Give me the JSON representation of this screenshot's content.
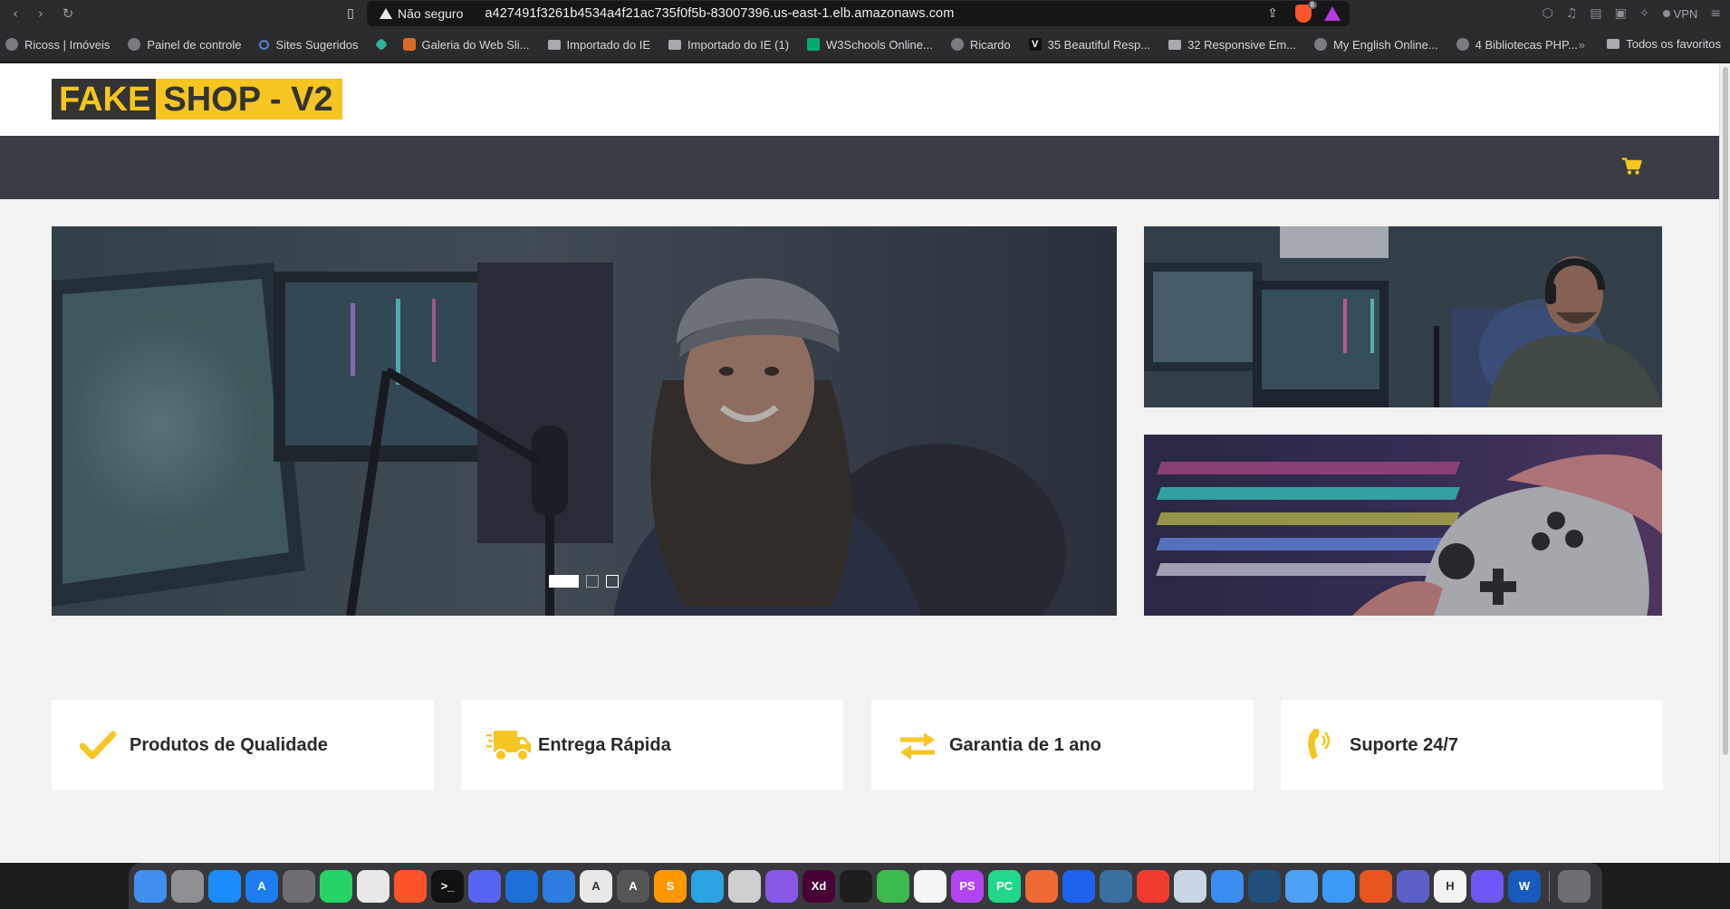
{
  "browser": {
    "security_label": "Não seguro",
    "url": "a427491f3261b4534a4f21ac735f0f5b-83007396.us-east-1.elb.amazonaws.com",
    "brave_badge": "8",
    "vpn_label": "VPN"
  },
  "bookmarks": {
    "items": [
      {
        "label": "Ricoss | Imóveis",
        "icon": "globe-icon"
      },
      {
        "label": "Painel de controle",
        "icon": "globe-icon"
      },
      {
        "label": "Sites Sugeridos",
        "icon": "search-icon"
      },
      {
        "label": "",
        "icon": "gem-icon"
      },
      {
        "label": "Galeria do Web Sli...",
        "icon": "paint-icon"
      },
      {
        "label": "Importado do IE",
        "icon": "folder-icon"
      },
      {
        "label": "Importado do IE (1)",
        "icon": "folder-icon"
      },
      {
        "label": "W3Schools Online...",
        "icon": "w3-icon"
      },
      {
        "label": "Ricardo",
        "icon": "globe-icon"
      },
      {
        "label": "35 Beautiful Resp...",
        "icon": "v-icon"
      },
      {
        "label": "32 Responsive Em...",
        "icon": "chart-icon"
      },
      {
        "label": "My English Online...",
        "icon": "globe-icon"
      },
      {
        "label": "4 Bibliotecas PHP...",
        "icon": "globe-icon"
      }
    ],
    "overflow": "»",
    "favorites_label": "Todos os favoritos"
  },
  "site": {
    "logo_part1": "FAKE",
    "logo_part2": "SHOP - V2",
    "accent_color": "#f5c522",
    "navbar_color": "#3a3d45"
  },
  "carousel": {
    "slides": 3,
    "active_index": 0
  },
  "features": [
    {
      "label": "Produtos de Qualidade",
      "icon": "check-icon"
    },
    {
      "label": "Entrega Rápida",
      "icon": "truck-icon"
    },
    {
      "label": "Garantia de 1 ano",
      "icon": "exchange-arrows-icon"
    },
    {
      "label": "Suporte 24/7",
      "icon": "phone-volume-icon"
    }
  ],
  "dock": {
    "apps": [
      {
        "name": "finder-icon",
        "color": "#3f8ef0",
        "text": ""
      },
      {
        "name": "launchpad-icon",
        "color": "#8e8e93",
        "text": ""
      },
      {
        "name": "safari-icon",
        "color": "#1a8cff",
        "text": ""
      },
      {
        "name": "app-store-icon",
        "color": "#1c7cf0",
        "text": "A"
      },
      {
        "name": "system-settings-icon",
        "color": "#6e6e73",
        "text": ""
      },
      {
        "name": "whatsapp-icon",
        "color": "#25d366",
        "text": ""
      },
      {
        "name": "chrome-icon",
        "color": "#e8e8e8",
        "text": ""
      },
      {
        "name": "brave-icon",
        "color": "#fb542b",
        "text": ""
      },
      {
        "name": "terminal-icon",
        "color": "#111111",
        "text": ">_"
      },
      {
        "name": "discord-icon",
        "color": "#5865f2",
        "text": ""
      },
      {
        "name": "xcode-icon",
        "color": "#1b6fd6",
        "text": ""
      },
      {
        "name": "simulator-icon",
        "color": "#2d7de0",
        "text": ""
      },
      {
        "name": "instruments-icon",
        "color": "#e8e8e8",
        "text": "A"
      },
      {
        "name": "font-book-icon",
        "color": "#555555",
        "text": "A"
      },
      {
        "name": "sublime-icon",
        "color": "#ff9800",
        "text": "S"
      },
      {
        "name": "telegram-icon",
        "color": "#2aa3e0",
        "text": ""
      },
      {
        "name": "utility-icon",
        "color": "#cfcfcf",
        "text": ""
      },
      {
        "name": "github-icon",
        "color": "#8957e5",
        "text": ""
      },
      {
        "name": "adobe-xd-icon",
        "color": "#470137",
        "text": "Xd"
      },
      {
        "name": "figma-icon",
        "color": "#1e1e1e",
        "text": ""
      },
      {
        "name": "cloud-icon",
        "color": "#3dba4e",
        "text": ""
      },
      {
        "name": "vscode-icon",
        "color": "#f5f5f5",
        "text": ""
      },
      {
        "name": "phpstorm-icon",
        "color": "#b345f1",
        "text": "PS"
      },
      {
        "name": "pycharm-icon",
        "color": "#21d789",
        "text": "PC"
      },
      {
        "name": "pen-tool-icon",
        "color": "#f06a35",
        "text": ""
      },
      {
        "name": "docker-icon",
        "color": "#1d63ed",
        "text": ""
      },
      {
        "name": "dbeaver-icon",
        "color": "#3b6fa0",
        "text": ""
      },
      {
        "name": "git-icon",
        "color": "#f03c2e",
        "text": ""
      },
      {
        "name": "postgres-icon",
        "color": "#c9d6e3",
        "text": ""
      },
      {
        "name": "mail-icon",
        "color": "#3a8ef0",
        "text": ""
      },
      {
        "name": "mysql-workbench-icon",
        "color": "#1f4f7a",
        "text": ""
      },
      {
        "name": "home-icon",
        "color": "#4ea2f5",
        "text": ""
      },
      {
        "name": "swift-icon",
        "color": "#3a9af5",
        "text": ""
      },
      {
        "name": "ubuntu-icon",
        "color": "#e95420",
        "text": ""
      },
      {
        "name": "teams-icon",
        "color": "#5b5fc7",
        "text": ""
      },
      {
        "name": "heroku-icon",
        "color": "#f2f2f2",
        "text": "H"
      },
      {
        "name": "loop-icon",
        "color": "#6b58f5",
        "text": ""
      },
      {
        "name": "word-icon",
        "color": "#185abd",
        "text": "W"
      }
    ],
    "trash": {
      "name": "trash-icon",
      "color": "#6e6e73"
    }
  }
}
